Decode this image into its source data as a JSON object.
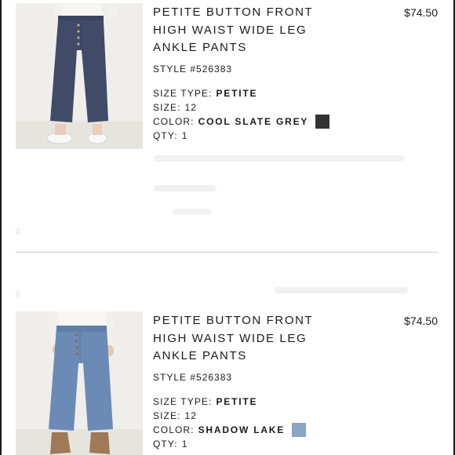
{
  "items": [
    {
      "name_lines": [
        "PETITE BUTTON FRONT",
        "HIGH WAIST WIDE LEG",
        "ANKLE PANTS"
      ],
      "style_label": "STYLE #526383",
      "size_type_label": "SIZE TYPE:",
      "size_type": "PETITE",
      "size_label": "SIZE:",
      "size": "12",
      "color_label": "COLOR:",
      "color": "COOL SLATE GREY",
      "swatch_hex": "#333333",
      "qty_label": "QTY:",
      "qty": "1",
      "price": "$74.50",
      "image_icon": "navy-pants-photo"
    },
    {
      "name_lines": [
        "PETITE BUTTON FRONT",
        "HIGH WAIST WIDE LEG",
        "ANKLE PANTS"
      ],
      "style_label": "STYLE #526383",
      "size_type_label": "SIZE TYPE:",
      "size_type": "PETITE",
      "size_label": "SIZE:",
      "size": "12",
      "color_label": "COLOR:",
      "color": "SHADOW LAKE",
      "swatch_hex": "#8aa6c4",
      "qty_label": "QTY:",
      "qty": "1",
      "price": "$74.50",
      "image_icon": "blue-pants-photo"
    }
  ]
}
